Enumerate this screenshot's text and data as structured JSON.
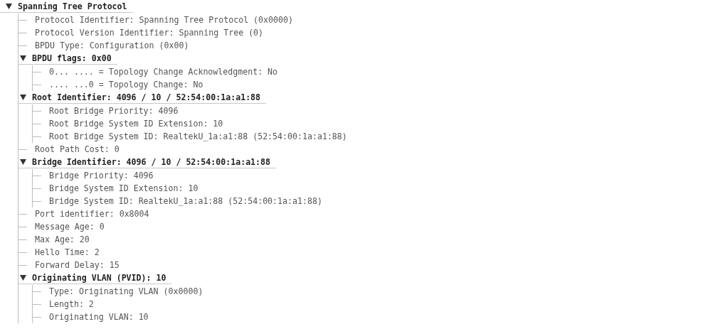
{
  "tree": [
    {
      "kind": "section",
      "label": "Spanning Tree Protocol",
      "expanded": true,
      "children": [
        {
          "kind": "field",
          "label": "Protocol Identifier: Spanning Tree Protocol (0x0000)"
        },
        {
          "kind": "field",
          "label": "Protocol Version Identifier: Spanning Tree (0)"
        },
        {
          "kind": "field",
          "label": "BPDU Type: Configuration (0x00)"
        },
        {
          "kind": "section",
          "label": "BPDU flags: 0x00",
          "expanded": true,
          "children": [
            {
              "kind": "field",
              "label": "0... .... = Topology Change Acknowledgment: No"
            },
            {
              "kind": "field",
              "label": ".... ...0 = Topology Change: No"
            }
          ]
        },
        {
          "kind": "section",
          "label": "Root Identifier: 4096 / 10 / 52:54:00:1a:a1:88",
          "expanded": true,
          "children": [
            {
              "kind": "field",
              "label": "Root Bridge Priority: 4096"
            },
            {
              "kind": "field",
              "label": "Root Bridge System ID Extension: 10"
            },
            {
              "kind": "field",
              "label": "Root Bridge System ID: RealtekU_1a:a1:88 (52:54:00:1a:a1:88)"
            }
          ]
        },
        {
          "kind": "field",
          "label": "Root Path Cost: 0"
        },
        {
          "kind": "section",
          "label": "Bridge Identifier: 4096 / 10 / 52:54:00:1a:a1:88",
          "expanded": true,
          "children": [
            {
              "kind": "field",
              "label": "Bridge Priority: 4096"
            },
            {
              "kind": "field",
              "label": "Bridge System ID Extension: 10"
            },
            {
              "kind": "field",
              "label": "Bridge System ID: RealtekU_1a:a1:88 (52:54:00:1a:a1:88)"
            }
          ]
        },
        {
          "kind": "field",
          "label": "Port identifier: 0x8004"
        },
        {
          "kind": "field",
          "label": "Message Age: 0"
        },
        {
          "kind": "field",
          "label": "Max Age: 20"
        },
        {
          "kind": "field",
          "label": "Hello Time: 2"
        },
        {
          "kind": "field",
          "label": "Forward Delay: 15"
        },
        {
          "kind": "section",
          "label": "Originating VLAN (PVID): 10",
          "expanded": true,
          "children": [
            {
              "kind": "field",
              "label": "Type: Originating VLAN (0x0000)"
            },
            {
              "kind": "field",
              "label": "Length: 2"
            },
            {
              "kind": "field",
              "label": "Originating VLAN: 10"
            }
          ]
        }
      ]
    }
  ]
}
